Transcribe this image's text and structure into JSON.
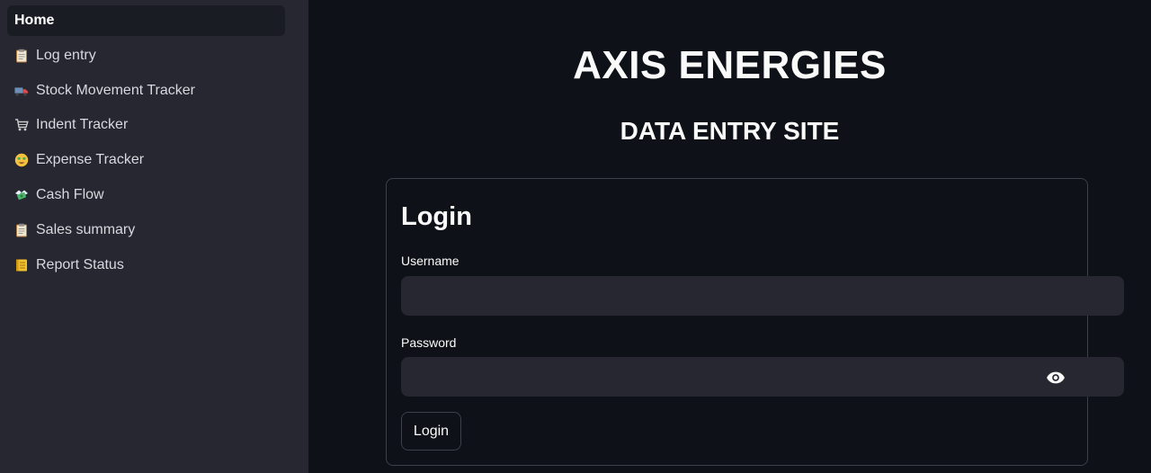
{
  "sidebar": {
    "items": [
      {
        "label": "Home",
        "icon": "",
        "active": true
      },
      {
        "label": "Log entry",
        "icon": "clipboard-icon"
      },
      {
        "label": "Stock Movement Tracker",
        "icon": "truck-icon"
      },
      {
        "label": "Indent Tracker",
        "icon": "cart-icon"
      },
      {
        "label": "Expense Tracker",
        "icon": "money-face-icon"
      },
      {
        "label": "Cash Flow",
        "icon": "flying-money-icon"
      },
      {
        "label": "Sales summary",
        "icon": "clipboard-icon"
      },
      {
        "label": "Report Status",
        "icon": "ledger-icon"
      }
    ]
  },
  "main": {
    "title": "AXIS ENERGIES",
    "subtitle": "DATA ENTRY SITE"
  },
  "login": {
    "heading": "Login",
    "username_label": "Username",
    "username_value": "",
    "password_label": "Password",
    "password_value": "",
    "button_label": "Login"
  },
  "colors": {
    "sidebar_bg": "#262730",
    "main_bg": "#0e1117",
    "input_bg": "#262730",
    "border": "#3d3f4a"
  }
}
